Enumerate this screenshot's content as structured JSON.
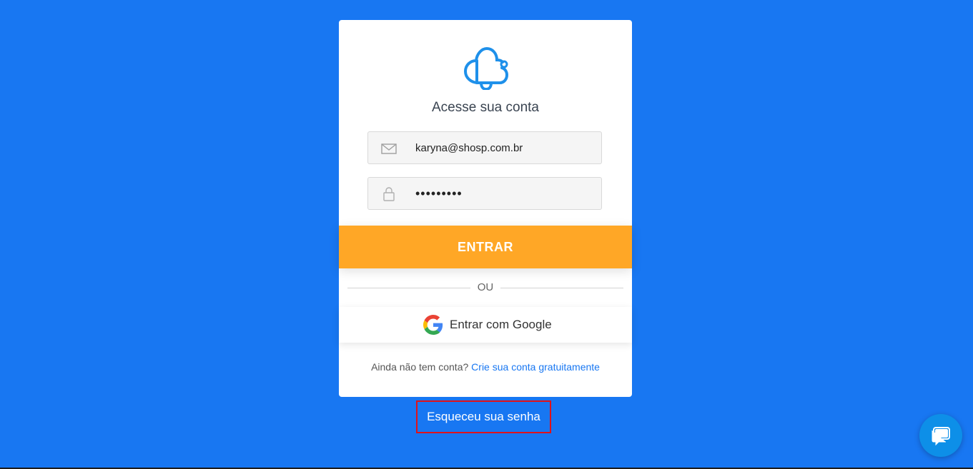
{
  "login": {
    "title": "Acesse sua conta",
    "email_value": "karyna@shosp.com.br",
    "password_value": "•••••••••",
    "enter_label": "ENTRAR",
    "divider_label": "OU",
    "google_label": "Entrar com Google",
    "signup_prompt": "Ainda não tem conta?",
    "signup_link": "Crie sua conta gratuitamente"
  },
  "forgot_password_label": "Esqueceu sua senha",
  "icons": {
    "logo": "cloud-stethoscope-logo",
    "email": "envelope-icon",
    "password": "lock-icon",
    "google": "google-icon",
    "chat": "chat-bubble-icon"
  },
  "colors": {
    "background": "#1877f2",
    "primary_button": "#ffa726",
    "link": "#1877f2",
    "highlight_box": "#e0121a",
    "chat_button": "#0d8fe8"
  }
}
